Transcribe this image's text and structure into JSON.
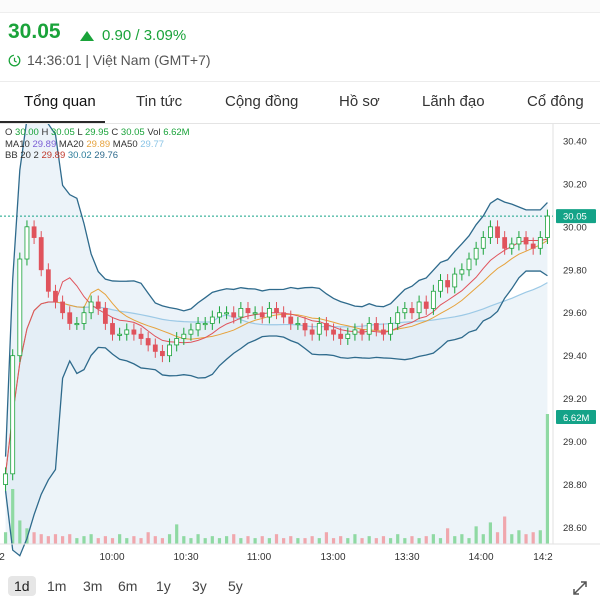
{
  "header": {
    "price": "30.05",
    "change": "0.90 / 3.09%",
    "time": "14:36:01 | Việt Nam (GMT+7)"
  },
  "tabs": [
    "Tổng quan",
    "Tin tức",
    "Cộng đồng",
    "Hồ sơ",
    "Lãnh đạo",
    "Cổ đông"
  ],
  "active_tab": "Tổng quan",
  "legend": {
    "o_label": "O",
    "o": "30.00",
    "h_label": "H",
    "h": "30.05",
    "l_label": "L",
    "l": "29.95",
    "c_label": "C",
    "c": "30.05",
    "vol_label": "Vol",
    "vol": "6.62M",
    "ma10_label": "MA10",
    "ma10": "29.89",
    "ma20_label": "MA20",
    "ma20": "29.89",
    "ma50_label": "MA50",
    "ma50": "29.77",
    "bb_label": "BB 20 2",
    "bb_lower": "29.89",
    "bb_mid": "30.02",
    "bb_upper": "29.76"
  },
  "chart_data": {
    "type": "candlestick",
    "y_ticks": [
      "30.40",
      "30.20",
      "30.00",
      "29.80",
      "29.60",
      "29.40",
      "29.20",
      "29.00",
      "28.80",
      "28.60"
    ],
    "x_ticks": [
      "2",
      "10:00",
      "10:30",
      "11:00",
      "13:00",
      "13:30",
      "14:00",
      "14:2"
    ],
    "ylim": [
      28.5,
      30.46
    ],
    "last_price_label": "30.05",
    "last_price": 30.05,
    "volume_label": "6.62M",
    "close_series": [
      28.85,
      29.4,
      29.85,
      30.0,
      29.95,
      29.8,
      29.7,
      29.65,
      29.6,
      29.55,
      29.55,
      29.6,
      29.65,
      29.62,
      29.55,
      29.5,
      29.5,
      29.52,
      29.5,
      29.48,
      29.45,
      29.42,
      29.4,
      29.45,
      29.48,
      29.5,
      29.52,
      29.55,
      29.55,
      29.58,
      29.6,
      29.6,
      29.58,
      29.62,
      29.6,
      29.6,
      29.58,
      29.62,
      29.6,
      29.58,
      29.55,
      29.55,
      29.52,
      29.5,
      29.55,
      29.52,
      29.5,
      29.48,
      29.5,
      29.52,
      29.5,
      29.55,
      29.52,
      29.5,
      29.55,
      29.6,
      29.62,
      29.6,
      29.65,
      29.62,
      29.7,
      29.75,
      29.72,
      29.78,
      29.8,
      29.85,
      29.9,
      29.95,
      30.0,
      29.95,
      29.9,
      29.92,
      29.95,
      29.92,
      29.9,
      29.95,
      30.05
    ],
    "volume_series": [
      0.6,
      2.8,
      1.2,
      0.8,
      0.6,
      0.5,
      0.4,
      0.5,
      0.4,
      0.5,
      0.3,
      0.4,
      0.5,
      0.3,
      0.4,
      0.3,
      0.5,
      0.3,
      0.4,
      0.3,
      0.6,
      0.4,
      0.3,
      0.5,
      1.0,
      0.4,
      0.3,
      0.5,
      0.3,
      0.4,
      0.3,
      0.4,
      0.5,
      0.3,
      0.4,
      0.3,
      0.4,
      0.3,
      0.5,
      0.3,
      0.4,
      0.3,
      0.3,
      0.4,
      0.3,
      0.6,
      0.3,
      0.4,
      0.3,
      0.5,
      0.3,
      0.4,
      0.3,
      0.4,
      0.3,
      0.5,
      0.3,
      0.4,
      0.3,
      0.4,
      0.5,
      0.3,
      0.8,
      0.4,
      0.5,
      0.3,
      0.9,
      0.5,
      1.1,
      0.6,
      1.4,
      0.5,
      0.7,
      0.5,
      0.6,
      0.7,
      6.62
    ],
    "colors": {
      "up": "#1aa33a",
      "down": "#e0535c",
      "band": "#2e6a8c",
      "fill": "#e8f1f8",
      "tag": "#14a388"
    }
  },
  "periods": [
    "1d",
    "1m",
    "3m",
    "6m",
    "1y",
    "3y",
    "5y"
  ],
  "active_period": "1d",
  "icons": {
    "change_arrow": "up-triangle-icon",
    "clock": "clock-icon",
    "expand": "expand-icon"
  }
}
